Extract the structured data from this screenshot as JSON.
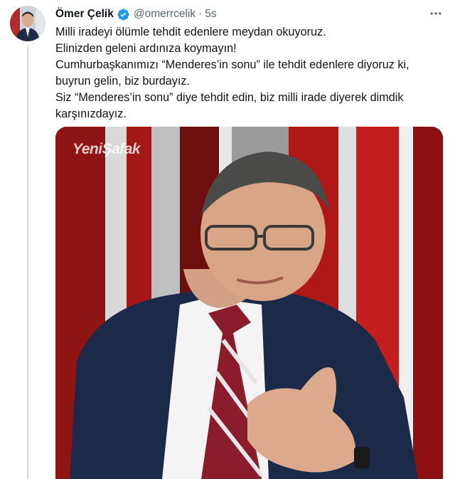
{
  "tweet": {
    "author_name": "Ömer Çelik",
    "handle": "@omerrcelik",
    "separator": "·",
    "time": "5s",
    "lines": [
      "Milli iradeyi ölümle tehdit edenlere meydan okuyoruz.",
      "Elinizden geleni ardınıza koymayın!",
      "Cumhurbaşkanımızı “Menderes’in sonu” ile tehdit edenlere diyoruz ki,",
      "buyrun gelin, biz burdayız.",
      "Siz “Menderes’in sonu” diye tehdit edin, biz milli irade diyerek dimdik",
      "karşınızdayız."
    ],
    "verified": true,
    "icons": {
      "verified": "verified-badge-icon",
      "more": "more-options-icon",
      "watermark": "yenisafak-logo"
    },
    "video_watermark": "YeniŞafak"
  },
  "colors": {
    "accent": "#1d9bf0",
    "text": "#0f1419",
    "secondary_text": "#536471",
    "thread_line": "#cfd9de"
  }
}
